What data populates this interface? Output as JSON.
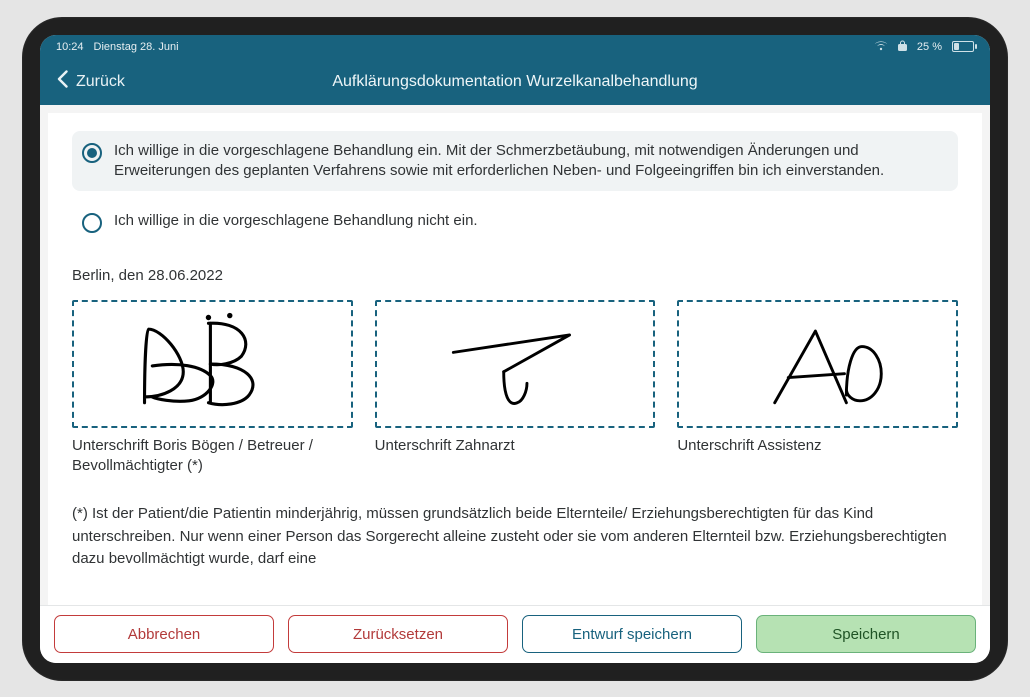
{
  "status": {
    "time": "10:24",
    "date": "Dienstag 28. Juni",
    "battery_text": "25 %",
    "battery_pct": 25
  },
  "nav": {
    "back_label": "Zurück",
    "title": "Aufklärungsdokumentation Wurzelkanalbehandlung"
  },
  "consent": {
    "options": [
      {
        "selected": true,
        "label": "Ich willige in die vorgeschlagene Behandlung ein. Mit der Schmerzbetäubung, mit notwendigen Änderungen und Erweiterungen des geplanten Verfahrens sowie mit erforderlichen Neben- und Folgeeingriffen bin ich einverstanden."
      },
      {
        "selected": false,
        "label": "Ich willige in die vorgeschlagene Behandlung nicht ein."
      }
    ]
  },
  "place_date": "Berlin, den 28.06.2022",
  "signatures": {
    "boxes": [
      {
        "label": "Unterschrift Boris Bögen / Betreuer / Bevollmächtigter (*)"
      },
      {
        "label": "Unterschrift Zahnarzt"
      },
      {
        "label": "Unterschrift Assistenz"
      }
    ]
  },
  "footnote": "(*) Ist der Patient/die Patientin minderjährig, müssen grundsätzlich beide Elternteile/ Erziehungsberechtigten für das Kind unterschreiben. Nur wenn einer Person das Sorgerecht alleine zusteht oder sie vom anderen Elternteil bzw. Erziehungsberechtigten dazu bevollmächtigt wurde, darf eine",
  "bottom_bar": {
    "cancel": "Abbrechen",
    "reset": "Zurücksetzen",
    "save_draft": "Entwurf speichern",
    "save": "Speichern"
  },
  "colors": {
    "brand": "#18627e",
    "danger": "#b23a3a",
    "success_bg": "#b6e2b3",
    "success_border": "#6ab27a",
    "success_text": "#1f5325"
  }
}
